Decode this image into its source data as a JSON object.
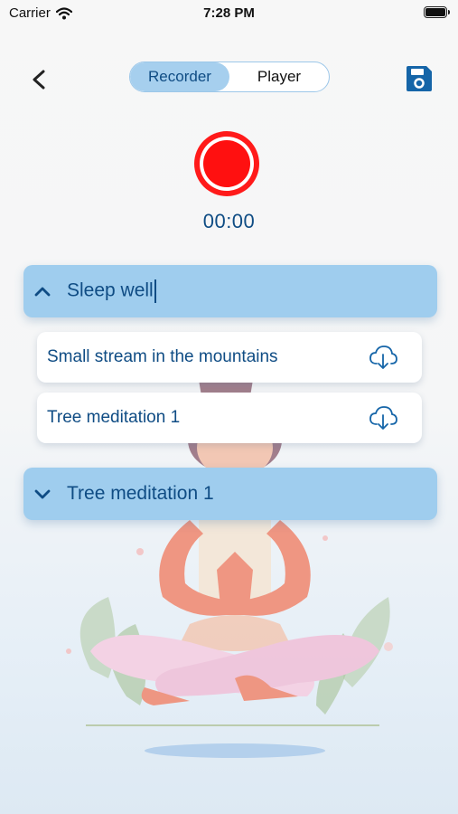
{
  "status_bar": {
    "carrier": "Carrier",
    "time": "7:28 PM"
  },
  "nav": {
    "tabs": [
      {
        "label": "Recorder",
        "active": true
      },
      {
        "label": "Player",
        "active": false
      }
    ]
  },
  "recorder": {
    "timer": "00:00"
  },
  "groups": [
    {
      "title": "Sleep well",
      "expanded": true,
      "items": [
        {
          "label": "Small stream in the mountains"
        },
        {
          "label": "Tree meditation 1"
        }
      ]
    },
    {
      "title": "Tree meditation 1",
      "expanded": false,
      "items": []
    }
  ],
  "colors": {
    "accent": "#0f4c84",
    "header_bg": "#9fcdee",
    "record": "#ff1a1a",
    "save_icon": "#1565a8"
  },
  "icons": [
    "back-chevron-icon",
    "save-disk-icon",
    "record-icon",
    "chevron-up-icon",
    "chevron-down-icon",
    "cloud-download-icon",
    "wifi-icon",
    "battery-icon"
  ]
}
